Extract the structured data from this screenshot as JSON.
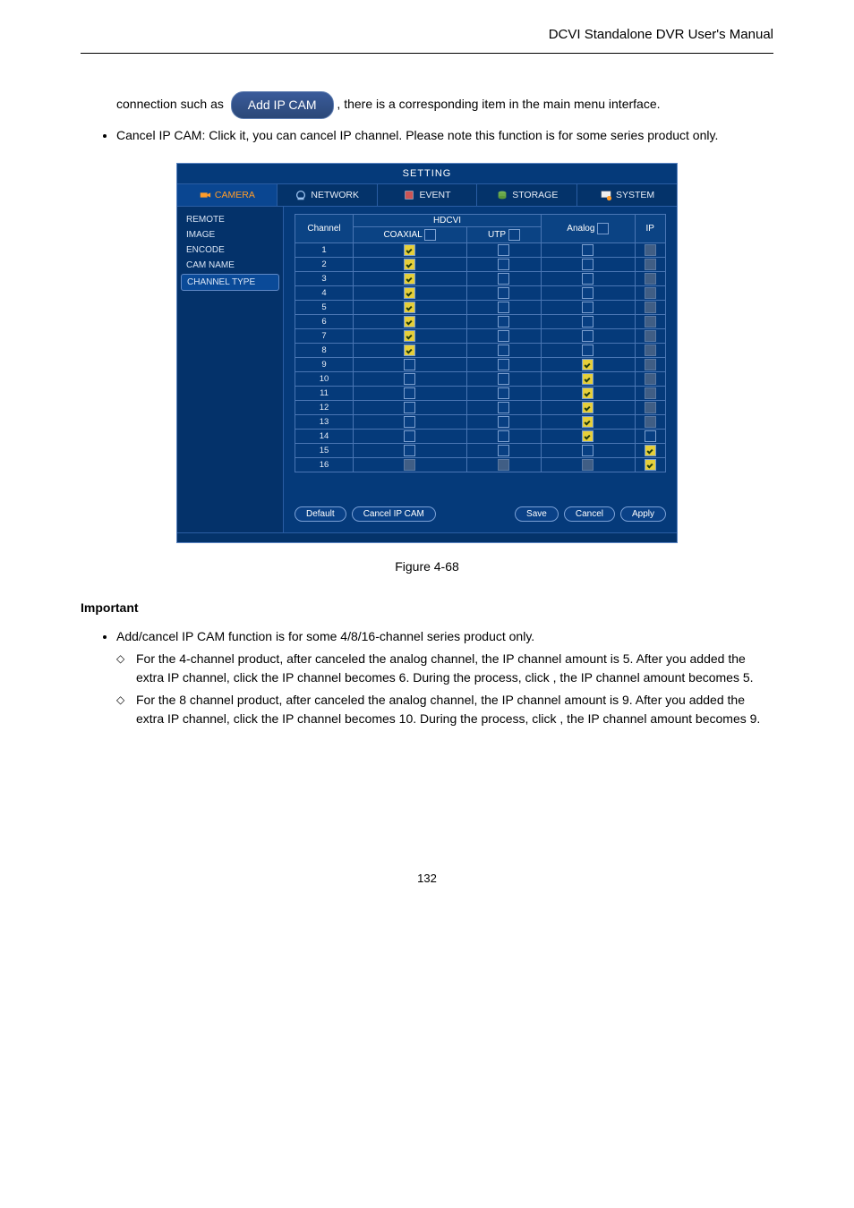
{
  "header": {
    "title": "DCVI Standalone DVR User's Manual"
  },
  "section1": {
    "para1": "connection such as ",
    "addipcam_label": "Add IP CAM",
    "para1b": ", there is a corresponding item in the main menu interface.",
    "bullet": "Cancel IP CAM: Click it, you can cancel IP channel. Please note this function is for some series product only."
  },
  "dvr": {
    "title": "SETTING",
    "tabs": [
      "CAMERA",
      "NETWORK",
      "EVENT",
      "STORAGE",
      "SYSTEM"
    ],
    "sidebar": [
      "REMOTE",
      "IMAGE",
      "ENCODE",
      "CAM NAME",
      "CHANNEL TYPE"
    ],
    "table": {
      "channel_hdr": "Channel",
      "hdcvi_hdr": "HDCVI",
      "coaxial_hdr": "COAXIAL",
      "utp_hdr": "UTP",
      "analog_hdr": "Analog",
      "ip_hdr": "IP",
      "rows": [
        {
          "ch": "1",
          "coax": "chk",
          "utp": "",
          "analog": "",
          "ip": "dis"
        },
        {
          "ch": "2",
          "coax": "chk",
          "utp": "",
          "analog": "",
          "ip": "dis"
        },
        {
          "ch": "3",
          "coax": "chk",
          "utp": "",
          "analog": "",
          "ip": "dis"
        },
        {
          "ch": "4",
          "coax": "chk",
          "utp": "",
          "analog": "",
          "ip": "dis"
        },
        {
          "ch": "5",
          "coax": "chk",
          "utp": "",
          "analog": "",
          "ip": "dis"
        },
        {
          "ch": "6",
          "coax": "chk",
          "utp": "",
          "analog": "",
          "ip": "dis"
        },
        {
          "ch": "7",
          "coax": "chk",
          "utp": "",
          "analog": "",
          "ip": "dis"
        },
        {
          "ch": "8",
          "coax": "chk",
          "utp": "",
          "analog": "",
          "ip": "dis"
        },
        {
          "ch": "9",
          "coax": "",
          "utp": "",
          "analog": "chk",
          "ip": "dis"
        },
        {
          "ch": "10",
          "coax": "",
          "utp": "",
          "analog": "chk",
          "ip": "dis"
        },
        {
          "ch": "11",
          "coax": "",
          "utp": "",
          "analog": "chk",
          "ip": "dis"
        },
        {
          "ch": "12",
          "coax": "",
          "utp": "",
          "analog": "chk",
          "ip": "dis"
        },
        {
          "ch": "13",
          "coax": "",
          "utp": "",
          "analog": "chk",
          "ip": "dis"
        },
        {
          "ch": "14",
          "coax": "",
          "utp": "",
          "analog": "chk",
          "ip": ""
        },
        {
          "ch": "15",
          "coax": "",
          "utp": "",
          "analog": "",
          "ip": "ipchk"
        },
        {
          "ch": "16",
          "coax": "dis",
          "utp": "dis",
          "analog": "dis",
          "ip": "ipchk"
        }
      ]
    },
    "buttons": {
      "default": "Default",
      "cancel_ip": "Cancel IP CAM",
      "save": "Save",
      "cancel": "Cancel",
      "apply": "Apply"
    }
  },
  "figure_caption": "Figure 4-68",
  "important": "Important",
  "bullet2": "Add/cancel IP CAM function is for some 4/8/16-channel series product only.",
  "diamond1a": "For the 4-channel product, after canceled the analog channel, the IP channel amount is 5.",
  "diamond1b": "After you added the extra IP channel, click ",
  "diamond1c": " the IP channel becomes 6.",
  "diamond1d": "During the process, click ",
  "diamond1e": ", the IP channel amount becomes 5.",
  "diamond2a": "For the 8 channel product, after canceled the analog channel, the IP channel amount is 9. After you added the extra IP channel, click ",
  "diamond2b": " the IP channel becomes 10. During the process, click ",
  "diamond2c": ", the IP channel amount becomes 9.",
  "page_num": "132"
}
